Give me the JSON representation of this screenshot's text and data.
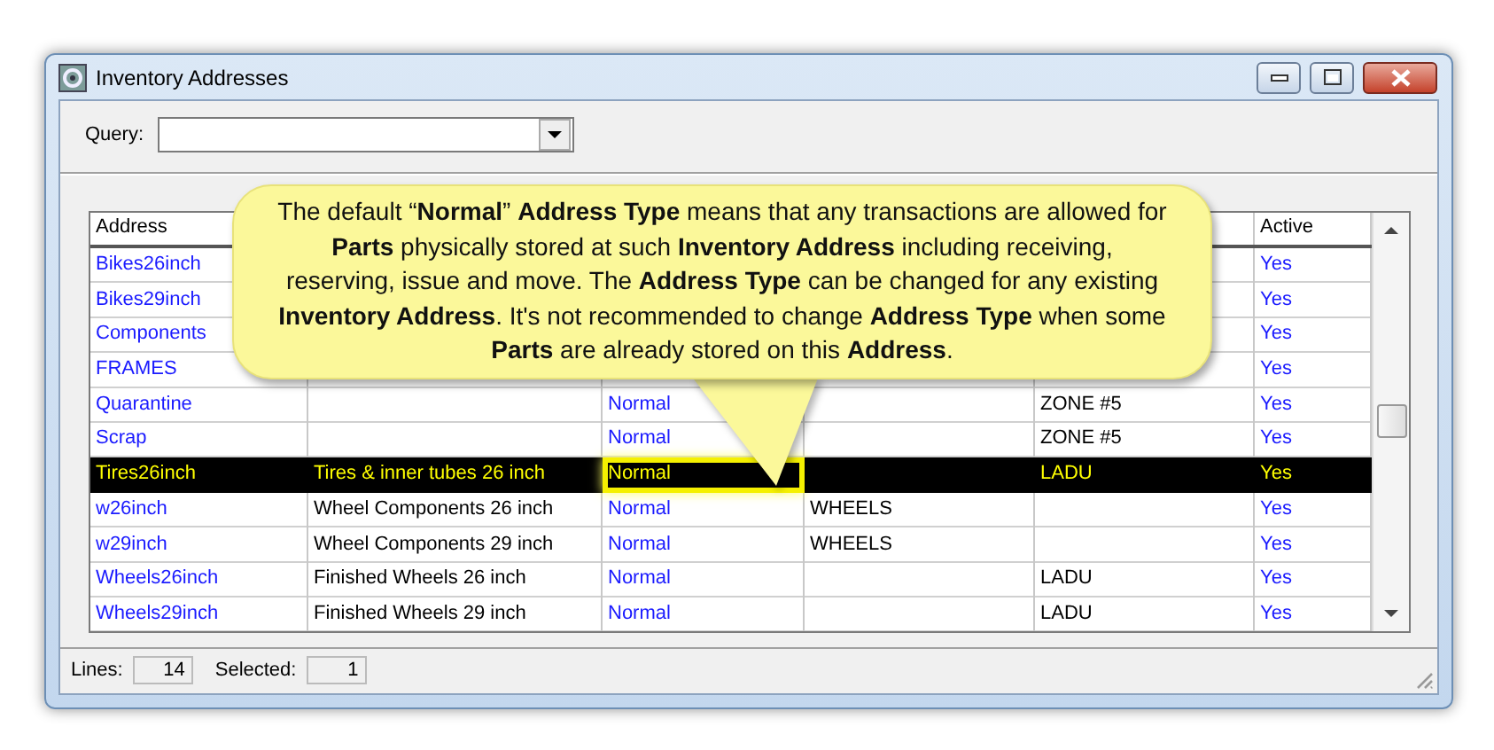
{
  "window": {
    "title": "Inventory Addresses"
  },
  "query": {
    "label": "Query:"
  },
  "table": {
    "columns": [
      {
        "label": "Address"
      },
      {},
      {},
      {},
      {},
      {
        "label": "Active"
      }
    ],
    "rows": [
      {
        "address": "Bikes26inch",
        "active": "Yes",
        "selected": false
      },
      {
        "address": "Bikes29inch",
        "active": "Yes",
        "selected": false
      },
      {
        "address": "Components",
        "active": "Yes",
        "selected": false
      },
      {
        "address": "FRAMES",
        "active": "Yes",
        "selected": false
      },
      {
        "address": "Quarantine",
        "type": "Normal",
        "column_5": "ZONE #5",
        "active": "Yes",
        "selected": false,
        "type_highlighted": false
      },
      {
        "address": "Scrap",
        "type": "Normal",
        "column_5": "ZONE #5",
        "active": "Yes",
        "selected": false,
        "type_highlighted": false
      },
      {
        "address": "Tires26inch",
        "description": "Tires & inner tubes 26 inch",
        "type": "Normal",
        "column_5": "LADU",
        "active": "Yes",
        "selected": true,
        "type_highlighted": true
      },
      {
        "address": "w26inch",
        "description": "Wheel Components 26 inch",
        "type": "Normal",
        "column_4": "WHEELS",
        "active": "Yes",
        "selected": false,
        "type_highlighted": false
      },
      {
        "address": "w29inch",
        "description": "Wheel Components 29 inch",
        "type": "Normal",
        "column_4": "WHEELS",
        "active": "Yes",
        "selected": false,
        "type_highlighted": false
      },
      {
        "address": "Wheels26inch",
        "description": "Finished Wheels 26 inch",
        "type": "Normal",
        "column_5": "LADU",
        "active": "Yes",
        "selected": false,
        "type_highlighted": false
      },
      {
        "address": "Wheels29inch",
        "description": "Finished Wheels 29 inch",
        "type": "Normal",
        "column_5": "LADU",
        "active": "Yes",
        "selected": false,
        "type_highlighted": false
      }
    ]
  },
  "callout": {
    "text": "The default “**Normal**” **Address Type** means that any transactions are allowed for **Parts** physically stored at such **Inventory Address** including receiving, reserving, issue and move.  The **Address Type** can be changed for any existing **Inventory Address**.  It's not recommended to change **Address Type** when some **Parts** are already stored on this **Address**."
  },
  "status_bar": {
    "lines_label": "Lines:",
    "lines": "14",
    "selected_label": "Selected:",
    "selected": "1"
  }
}
